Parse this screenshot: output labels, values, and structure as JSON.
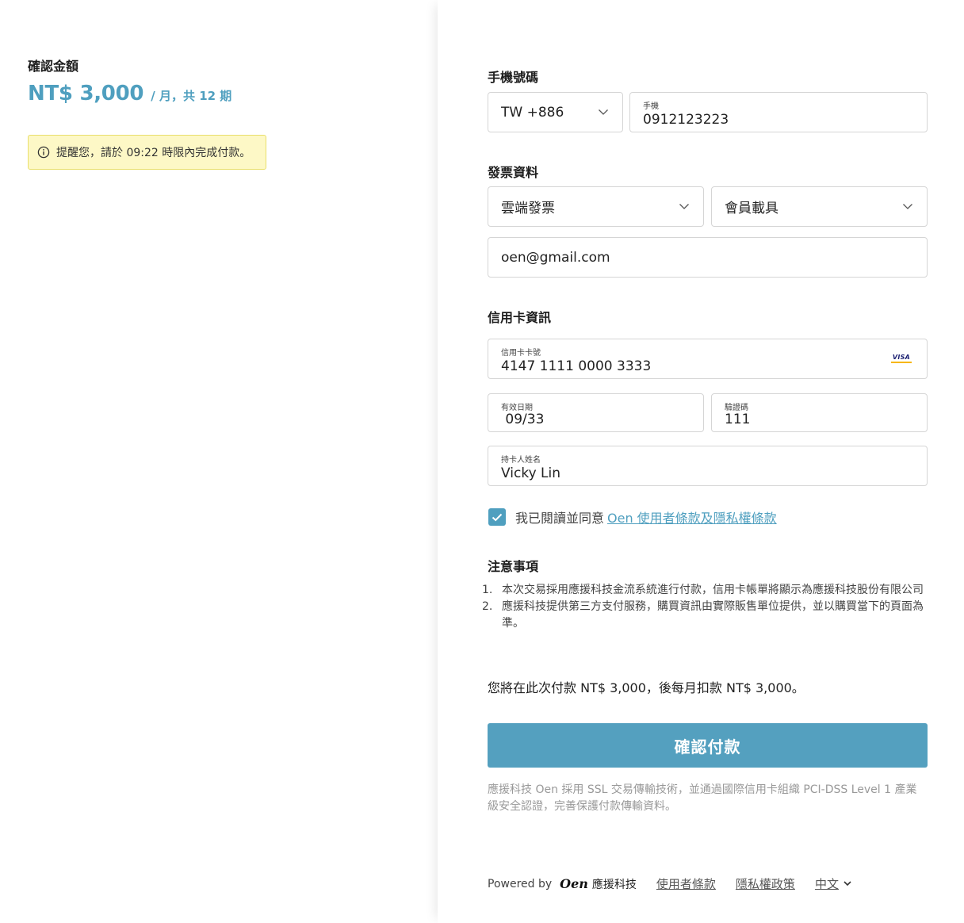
{
  "summary": {
    "title": "確認金額",
    "amount": "NT$ 3,000",
    "period": "/ 月，共 12 期",
    "reminder": "提醒您，請於 09:22 時限內完成付款。"
  },
  "phone": {
    "section_title": "手機號碼",
    "country_code": "TW +886",
    "label": "手機",
    "value": "0912123223"
  },
  "invoice": {
    "section_title": "發票資料",
    "type": "雲端發票",
    "carrier": "會員載具",
    "email": "oen@gmail.com"
  },
  "card": {
    "section_title": "信用卡資訊",
    "number_label": "信用卡卡號",
    "number": "4147 1111 0000 3333",
    "brand": "VISA",
    "expiry_label": "有效日期",
    "expiry": " 09/33",
    "cvc_label": "驗證碼",
    "cvc": "111",
    "holder_label": "持卡人姓名",
    "holder": "Vicky Lin"
  },
  "agreement": {
    "checked": true,
    "text": "我已閱讀並同意",
    "link": "Oen 使用者條款及隱私權條款"
  },
  "notes": {
    "title": "注意事項",
    "items": [
      {
        "num": "1.",
        "text": "本次交易採用應援科技金流系統進行付款，信用卡帳單將顯示為應援科技股份有限公司"
      },
      {
        "num": "2.",
        "text": "應援科技提供第三方支付服務，購買資訊由實際販售單位提供，並以購買當下的頁面為準。"
      }
    ]
  },
  "charge_text": "您將在此次付款 NT$ 3,000，後每月扣款 NT$ 3,000。",
  "confirm_button": "確認付款",
  "security_text": "應援科技 Oen 採用 SSL 交易傳輸技術，並通過國際信用卡組織 PCI-DSS Level 1 產業級安全認證，完善保護付款傳輸資料。",
  "footer": {
    "powered_by": "Powered by",
    "logo": "Oen",
    "brand": "應援科技",
    "terms": "使用者條款",
    "privacy": "隱私權政策",
    "language": "中文"
  },
  "colors": {
    "accent": "#4f9fbf",
    "button": "#54a0bf",
    "reminder_bg": "#fdf8c6",
    "reminder_border": "#e9df6b"
  }
}
